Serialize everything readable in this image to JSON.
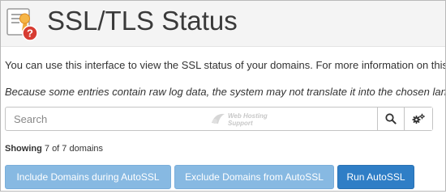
{
  "header": {
    "title": "SSL/TLS Status",
    "icon": "certificate-warning-icon",
    "icon_badge": "?"
  },
  "description": {
    "line1": "You can use this interface to view the SSL status of your domains. For more information on this in",
    "line2": "Because some entries contain raw log data, the system may not translate it into the chosen language or"
  },
  "search": {
    "placeholder": "Search",
    "value": "",
    "search_icon": "search-icon",
    "settings_icon": "settings-icon"
  },
  "watermark": {
    "text_line1": "Web Hosting",
    "text_line2": "Support"
  },
  "showing": {
    "label": "Showing",
    "text": "7 of 7 domains"
  },
  "actions": {
    "include": "Include Domains during AutoSSL",
    "exclude": "Exclude Domains from AutoSSL",
    "run": "Run AutoSSL"
  },
  "colors": {
    "header_bg": "#f4f4f4",
    "light_button": "#87b9e2",
    "primary_button": "#2f7ec6",
    "badge_red": "#d73c32",
    "ribbon_orange": "#f0a83a"
  }
}
